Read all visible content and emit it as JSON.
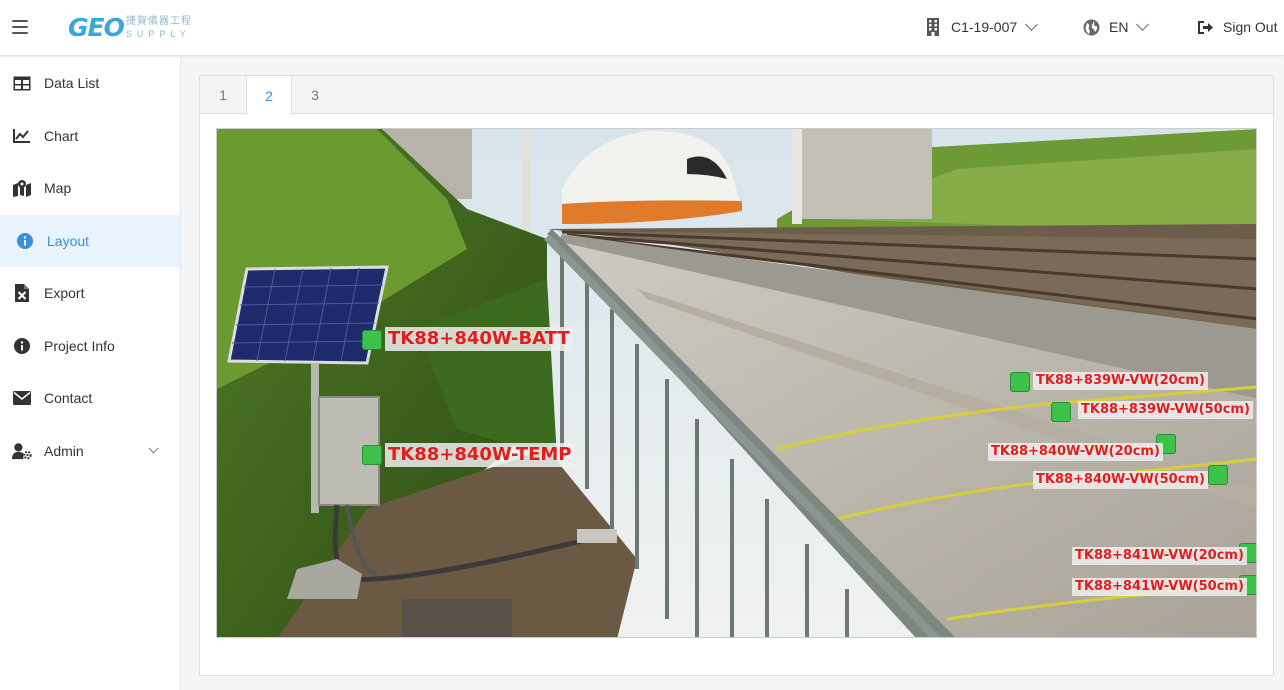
{
  "header": {
    "logo": {
      "text": "GEO",
      "subtitle_cn": "捷賀儀器工程",
      "subtitle_en": "SUPPLY"
    },
    "project": "C1-19-007",
    "language": "EN",
    "sign_out": "Sign Out"
  },
  "sidebar": {
    "items": [
      {
        "label": "Data List",
        "icon": "table-icon"
      },
      {
        "label": "Chart",
        "icon": "line-chart-icon"
      },
      {
        "label": "Map",
        "icon": "map-icon"
      },
      {
        "label": "Layout",
        "icon": "info-icon"
      },
      {
        "label": "Export",
        "icon": "excel-file-icon"
      },
      {
        "label": "Project Info",
        "icon": "info-icon"
      },
      {
        "label": "Contact",
        "icon": "envelope-icon"
      },
      {
        "label": "Admin",
        "icon": "user-gear-icon"
      }
    ],
    "active": "Layout"
  },
  "tabs": [
    "1",
    "2",
    "3"
  ],
  "active_tab": "2",
  "sensors": [
    {
      "label": "TK88+840W-BATT",
      "status_color": "#3cc24a"
    },
    {
      "label": "TK88+840W-TEMP",
      "status_color": "#3cc24a"
    },
    {
      "label": "TK88+839W-VW(20cm)",
      "status_color": "#3cc24a"
    },
    {
      "label": "TK88+839W-VW(50cm)",
      "status_color": "#3cc24a"
    },
    {
      "label": "TK88+840W-VW(20cm)",
      "status_color": "#3cc24a"
    },
    {
      "label": "TK88+840W-VW(50cm)",
      "status_color": "#3cc24a"
    },
    {
      "label": "TK88+841W-VW(20cm)",
      "status_color": "#3cc24a"
    },
    {
      "label": "TK88+841W-VW(50cm)",
      "status_color": "#3cc24a"
    }
  ],
  "colors": {
    "accent": "#3a8fd6",
    "sensor_ok": "#3cc24a",
    "sensor_label": "#e21b1b"
  }
}
